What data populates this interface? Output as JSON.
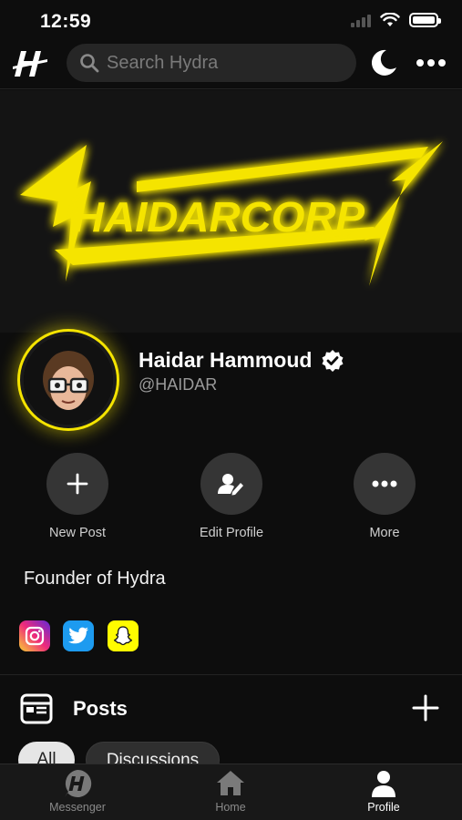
{
  "status_bar": {
    "time": "12:59"
  },
  "search": {
    "placeholder": "Search Hydra"
  },
  "banner": {
    "logo_text": "HAIDARCORP"
  },
  "profile": {
    "name": "Haidar Hammoud",
    "handle": "@HAIDAR",
    "verified": true,
    "bio": "Founder of Hydra"
  },
  "actions": [
    {
      "label": "New Post",
      "icon": "plus-icon"
    },
    {
      "label": "Edit Profile",
      "icon": "edit-profile-icon"
    },
    {
      "label": "More",
      "icon": "more-icon"
    }
  ],
  "socials": [
    {
      "name": "instagram-icon",
      "color": "#e1306c"
    },
    {
      "name": "twitter-icon",
      "color": "#1d9bf0"
    },
    {
      "name": "snapchat-icon",
      "color": "#fffc00"
    }
  ],
  "posts": {
    "title": "Posts",
    "tabs": [
      {
        "label": "All",
        "selected": true
      },
      {
        "label": "Discussions",
        "selected": false
      }
    ]
  },
  "bottom_nav": {
    "items": [
      {
        "label": "Messenger",
        "icon": "hydra-messenger-icon",
        "active": false
      },
      {
        "label": "Home",
        "icon": "home-icon",
        "active": false
      },
      {
        "label": "Profile",
        "icon": "profile-icon",
        "active": true
      }
    ]
  },
  "colors": {
    "accent": "#f5e400",
    "background": "#0d0d0d",
    "surface": "#353535"
  }
}
